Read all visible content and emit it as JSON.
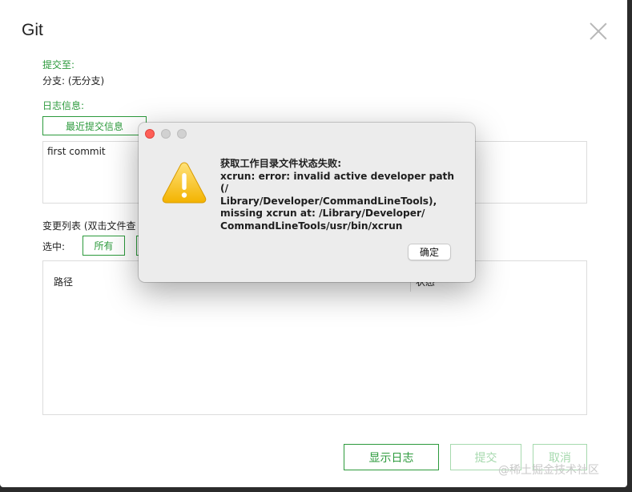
{
  "window": {
    "title": "Git"
  },
  "commit_to": {
    "label": "提交至:",
    "branch": "分支: (无分支)"
  },
  "log_info": {
    "label": "日志信息:",
    "recent_button": "最近提交信息",
    "message": "first commit"
  },
  "change_list": {
    "label": "变更列表 (双击文件查",
    "select_label": "选中:",
    "all_button": "所有",
    "col_path": "路径",
    "col_status": "状态"
  },
  "footer": {
    "show_log": "显示日志",
    "commit": "提交",
    "cancel": "取消"
  },
  "dialog": {
    "message": "获取工作目录文件状态失败:\nxcrun: error: invalid active developer path (/\nLibrary/Developer/CommandLineTools),\nmissing xcrun at: /Library/Developer/\nCommandLineTools/usr/bin/xcrun",
    "ok": "确定"
  },
  "watermark": "@稀土掘金技术社区",
  "colors": {
    "accent": "#2c9a3c",
    "accent_disabled": "#a6d9ae",
    "dialog_bg": "#ececec",
    "close_red": "#fe5f57"
  },
  "icons": {
    "close": "close-icon",
    "warning": "warning-icon"
  }
}
